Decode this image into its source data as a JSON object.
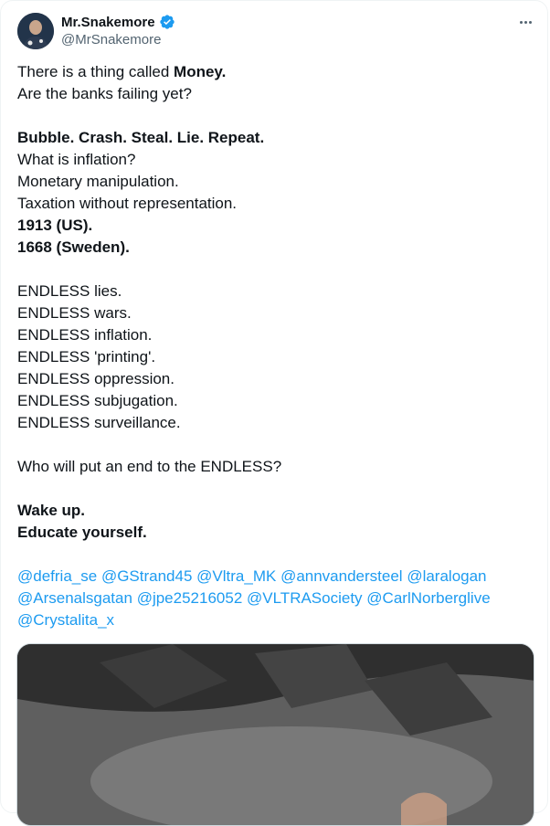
{
  "author": {
    "display_name": "Mr.Snakemore",
    "handle": "@MrSnakemore",
    "verified": true
  },
  "post": {
    "lines": [
      {
        "parts": [
          {
            "text": "There is a thing called ",
            "bold": false
          },
          {
            "text": "Money.",
            "bold": true
          }
        ]
      },
      {
        "parts": [
          {
            "text": "Are the banks failing yet?",
            "bold": false
          }
        ]
      },
      {
        "parts": []
      },
      {
        "parts": [
          {
            "text": "Bubble. Crash. Steal. Lie. Repeat.",
            "bold": true
          }
        ]
      },
      {
        "parts": [
          {
            "text": "What is inflation?",
            "bold": false
          }
        ]
      },
      {
        "parts": [
          {
            "text": "Monetary manipulation.",
            "bold": false
          }
        ]
      },
      {
        "parts": [
          {
            "text": "Taxation without representation.",
            "bold": false
          }
        ]
      },
      {
        "parts": [
          {
            "text": "1913 (US).",
            "bold": true
          }
        ]
      },
      {
        "parts": [
          {
            "text": "1668 (Sweden).",
            "bold": true
          }
        ]
      },
      {
        "parts": []
      },
      {
        "parts": [
          {
            "text": "ENDLESS lies.",
            "bold": false
          }
        ]
      },
      {
        "parts": [
          {
            "text": "ENDLESS wars.",
            "bold": false
          }
        ]
      },
      {
        "parts": [
          {
            "text": "ENDLESS inflation.",
            "bold": false
          }
        ]
      },
      {
        "parts": [
          {
            "text": "ENDLESS 'printing'.",
            "bold": false
          }
        ]
      },
      {
        "parts": [
          {
            "text": "ENDLESS oppression.",
            "bold": false
          }
        ]
      },
      {
        "parts": [
          {
            "text": "ENDLESS subjugation.",
            "bold": false
          }
        ]
      },
      {
        "parts": [
          {
            "text": "ENDLESS surveillance.",
            "bold": false
          }
        ]
      },
      {
        "parts": []
      },
      {
        "parts": [
          {
            "text": "Who will put an end to the ENDLESS?",
            "bold": false
          }
        ]
      },
      {
        "parts": []
      },
      {
        "parts": [
          {
            "text": "Wake up.",
            "bold": true
          }
        ]
      },
      {
        "parts": [
          {
            "text": "Educate yourself.",
            "bold": true
          }
        ]
      },
      {
        "parts": []
      }
    ],
    "mentions": [
      "@defria_se",
      "@GStrand45",
      "@Vltra_MK",
      "@annvandersteel",
      "@laralogan",
      "@Arsenalsgatan",
      "@jpe25216052",
      "@VLTRASociety",
      "@CarlNorberglive",
      "@Crystalita_x"
    ]
  },
  "colors": {
    "accent": "#1d9bf0",
    "text": "#0f1419",
    "muted": "#536471"
  },
  "icons": {
    "verified": "verified-badge-icon",
    "more": "more-options-icon"
  }
}
